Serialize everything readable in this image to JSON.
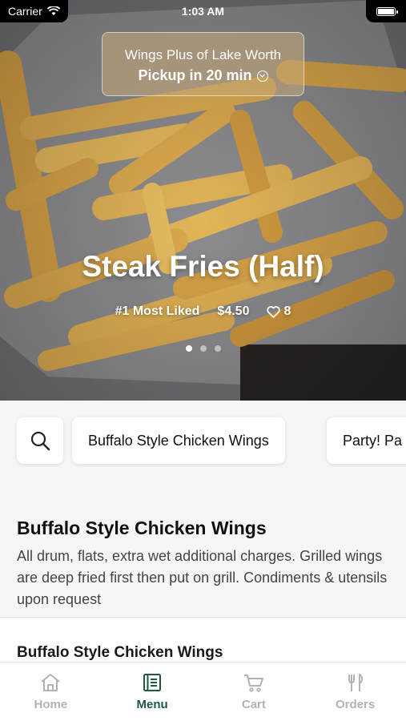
{
  "status_bar": {
    "carrier": "Carrier",
    "time": "1:03 AM"
  },
  "store": {
    "name": "Wings Plus of Lake Worth",
    "pickup": "Pickup in 20 min"
  },
  "featured": {
    "title": "Steak Fries (Half)",
    "rank": "#1 Most Liked",
    "price": "$4.50",
    "likes": "8",
    "slides": 3,
    "active_slide": 1
  },
  "categories": [
    "Buffalo Style Chicken Wings",
    "Party! Pa"
  ],
  "section": {
    "title": "Buffalo Style Chicken Wings",
    "description": "All drum, flats, extra wet additional charges. Grilled wings are deep fried first then put on grill. Condiments & utensils upon request"
  },
  "first_item": {
    "name": "Buffalo Style Chicken Wings"
  },
  "tabs": [
    {
      "label": "Home",
      "icon": "home-icon",
      "active": false
    },
    {
      "label": "Menu",
      "icon": "menu-icon",
      "active": true
    },
    {
      "label": "Cart",
      "icon": "cart-icon",
      "active": false
    },
    {
      "label": "Orders",
      "icon": "orders-icon",
      "active": false
    }
  ],
  "colors": {
    "accent": "#1f5a3a",
    "inactive_tab": "#b3b3b3"
  }
}
